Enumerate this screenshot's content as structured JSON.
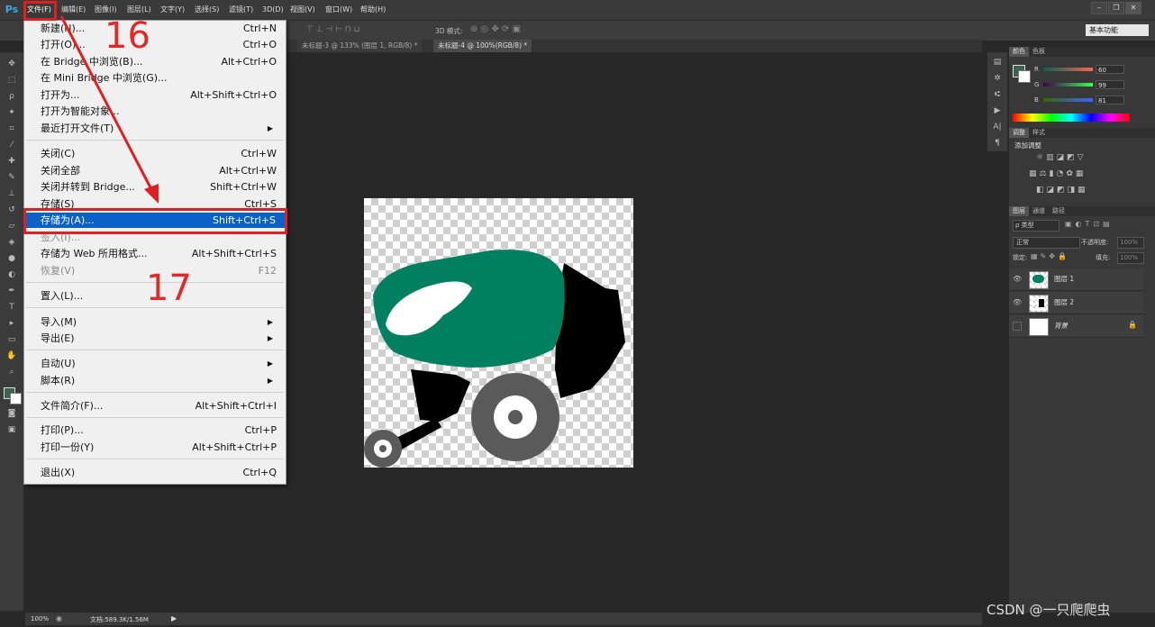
{
  "app": {
    "logo": "Ps"
  },
  "menubar": {
    "items": [
      "文件(F)",
      "编辑(E)",
      "图像(I)",
      "图层(L)",
      "文字(Y)",
      "选择(S)",
      "滤镜(T)",
      "3D(D)",
      "视图(V)",
      "窗口(W)",
      "帮助(H)"
    ],
    "window_buttons": [
      "–",
      "❐",
      "✕"
    ]
  },
  "options_bar": {
    "mode_label": "3D 模式:",
    "workspace": "基本功能"
  },
  "tabs": [
    {
      "label": "未标题-3 @ 133% (图层 1, RGB/8) *",
      "active": false
    },
    {
      "label": "未标题-4 @ 100%(RGB/8) *",
      "active": true
    }
  ],
  "file_menu": {
    "items": [
      {
        "label": "新建(N)...",
        "shortcut": "Ctrl+N"
      },
      {
        "label": "打开(O)...",
        "shortcut": "Ctrl+O"
      },
      {
        "label": "在 Bridge 中浏览(B)...",
        "shortcut": "Alt+Ctrl+O"
      },
      {
        "label": "在 Mini Bridge 中浏览(G)...",
        "shortcut": ""
      },
      {
        "label": "打开为...",
        "shortcut": "Alt+Shift+Ctrl+O"
      },
      {
        "label": "打开为智能对象...",
        "shortcut": ""
      },
      {
        "label": "最近打开文件(T)",
        "shortcut": ""
      },
      {
        "label": "关闭(C)",
        "shortcut": "Ctrl+W"
      },
      {
        "label": "关闭全部",
        "shortcut": "Alt+Ctrl+W"
      },
      {
        "label": "关闭并转到 Bridge...",
        "shortcut": "Shift+Ctrl+W"
      },
      {
        "label": "存储(S)",
        "shortcut": "Ctrl+S"
      },
      {
        "label": "存储为(A)...",
        "shortcut": "Shift+Ctrl+S"
      },
      {
        "label": "签入(I)...",
        "shortcut": ""
      },
      {
        "label": "存储为 Web 所用格式...",
        "shortcut": "Alt+Shift+Ctrl+S"
      },
      {
        "label": "恢复(V)",
        "shortcut": "F12"
      },
      {
        "label": "置入(L)...",
        "shortcut": ""
      },
      {
        "label": "导入(M)",
        "shortcut": ""
      },
      {
        "label": "导出(E)",
        "shortcut": ""
      },
      {
        "label": "自动(U)",
        "shortcut": ""
      },
      {
        "label": "脚本(R)",
        "shortcut": ""
      },
      {
        "label": "文件简介(F)...",
        "shortcut": "Alt+Shift+Ctrl+I"
      },
      {
        "label": "打印(P)...",
        "shortcut": "Ctrl+P"
      },
      {
        "label": "打印一份(Y)",
        "shortcut": "Alt+Shift+Ctrl+P"
      },
      {
        "label": "退出(X)",
        "shortcut": "Ctrl+Q"
      }
    ]
  },
  "annotations": {
    "step16": "16",
    "step17": "17"
  },
  "color_panel": {
    "tabs": [
      "颜色",
      "色板"
    ],
    "r_label": "R",
    "g_label": "G",
    "b_label": "B",
    "r": "60",
    "g": "99",
    "b": "81",
    "foreground": "#3c6351"
  },
  "adjust_panel": {
    "tabs": [
      "调整",
      "样式"
    ],
    "title": "添加调整"
  },
  "layers_panel": {
    "tabs": [
      "图层",
      "通道",
      "路径"
    ],
    "filter": "ρ 类型",
    "blend_mode": "正常",
    "opacity_label": "不透明度:",
    "opacity": "100%",
    "lock_label": "锁定:",
    "fill_label": "填充:",
    "fill": "100%",
    "layers": [
      {
        "name": "图层 1"
      },
      {
        "name": "图层 2"
      },
      {
        "name": "背景"
      }
    ]
  },
  "status": {
    "zoom": "100%",
    "doc": "文档:589.3K/1.56M"
  },
  "watermark": "CSDN @一只爬爬虫",
  "colors": {
    "accent_red": "#e02020",
    "highlight_blue": "#0a62c8",
    "mower_green": "#008060"
  }
}
